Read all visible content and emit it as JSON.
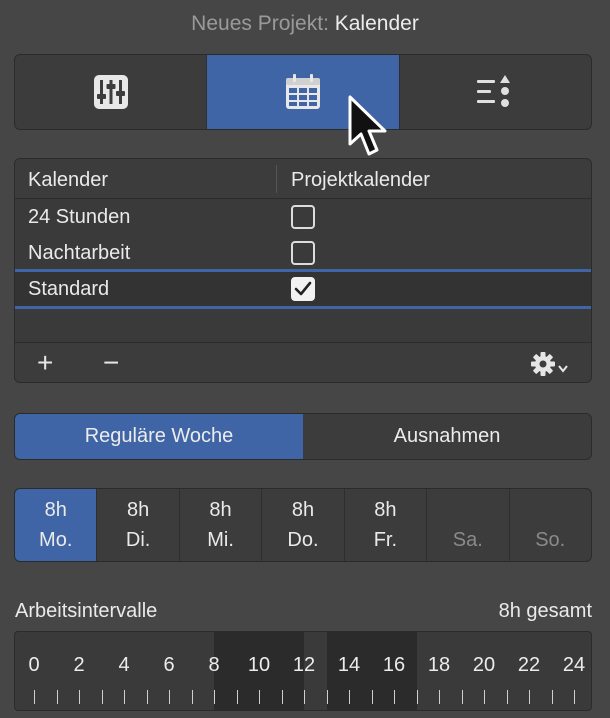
{
  "window": {
    "title_prefix": "Neues Projekt:",
    "title_value": "Kalender"
  },
  "toolbar": {
    "segments": [
      {
        "icon": "sliders-icon",
        "active": false
      },
      {
        "icon": "calendar-icon",
        "active": true
      },
      {
        "icon": "list-sort-icon",
        "active": false
      }
    ]
  },
  "calendar_table": {
    "columns": [
      "Kalender",
      "Projektkalender"
    ],
    "rows": [
      {
        "name": "24 Stunden",
        "project_calendar": false
      },
      {
        "name": "Nachtarbeit",
        "project_calendar": false
      },
      {
        "name": "Standard",
        "project_calendar": true,
        "selected": true
      }
    ],
    "footer": {
      "add_label": "+",
      "remove_label": "−",
      "actions_icon": "gear-dropdown-icon"
    }
  },
  "tabs": {
    "items": [
      "Reguläre Woche",
      "Ausnahmen"
    ],
    "active": "Reguläre Woche"
  },
  "week": {
    "days": [
      {
        "hours": "8h",
        "label": "Mo.",
        "active": true
      },
      {
        "hours": "8h",
        "label": "Di.",
        "active": false
      },
      {
        "hours": "8h",
        "label": "Mi.",
        "active": false
      },
      {
        "hours": "8h",
        "label": "Do.",
        "active": false
      },
      {
        "hours": "8h",
        "label": "Fr.",
        "active": false
      },
      {
        "hours": "",
        "label": "Sa.",
        "active": false
      },
      {
        "hours": "",
        "label": "So.",
        "active": false
      }
    ]
  },
  "intervals": {
    "label": "Arbeitsintervalle",
    "total": "8h gesamt",
    "axis_labels": [
      "0",
      "2",
      "4",
      "6",
      "8",
      "10",
      "12",
      "14",
      "16",
      "18",
      "20",
      "22",
      "24"
    ],
    "work_blocks": [
      [
        8,
        12
      ],
      [
        13,
        17
      ]
    ]
  },
  "colors": {
    "accent": "#3f65a6",
    "background": "#464646"
  }
}
